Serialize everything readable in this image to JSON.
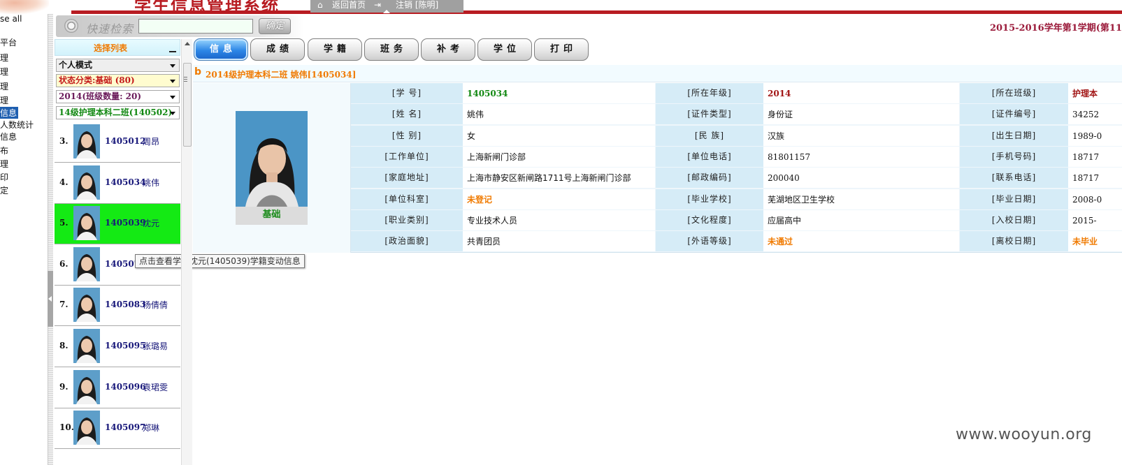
{
  "header": {
    "system_title": "学生信息管理系统",
    "nav_home": "返回首页",
    "nav_logout": "注销 [陈明]",
    "term": "2015-2016学年第1学期(第11"
  },
  "left_tree": {
    "items": [
      "se all",
      "平台",
      "理",
      "理",
      "理",
      "理",
      "信息",
      "人数统计",
      "信息",
      "布",
      "理",
      "印",
      "定"
    ],
    "selected_index": 6
  },
  "search": {
    "label": "快速检索",
    "value": "",
    "button": "确定"
  },
  "select_panel": {
    "title": "选择列表",
    "dropdowns": [
      {
        "value": "个人模式",
        "color": "#111111",
        "bg": "#eeeeee"
      },
      {
        "value": "状态分类:基础  (80)",
        "color": "#c41a1a",
        "bg": "#fffccf"
      },
      {
        "value": "2014(班级数量: 20)",
        "color": "#6a1a5a",
        "bg": "#ffffff"
      },
      {
        "value": "14级护理本科二班(140502)",
        "color": "#118811",
        "bg": "#ffffff"
      }
    ]
  },
  "students": [
    {
      "index": "3.",
      "id": "1405012",
      "name": "周昂",
      "active": false
    },
    {
      "index": "4.",
      "id": "1405034",
      "name": "姚伟",
      "active": false
    },
    {
      "index": "5.",
      "id": "1405039",
      "name": "沈元",
      "active": true
    },
    {
      "index": "6.",
      "id": "1405073",
      "name": "",
      "active": false
    },
    {
      "index": "7.",
      "id": "1405083",
      "name": "杨倩倩",
      "active": false
    },
    {
      "index": "8.",
      "id": "1405095",
      "name": "张璐易",
      "active": false
    },
    {
      "index": "9.",
      "id": "1405096",
      "name": "袁珺雯",
      "active": false
    },
    {
      "index": "10.",
      "id": "1405097",
      "name": "郑琳",
      "active": false
    }
  ],
  "tooltip": "点击查看学生沈元(1405039)学籍变动信息",
  "tabs": [
    "信息",
    "成绩",
    "学籍",
    "班务",
    "补考",
    "学位",
    "打印"
  ],
  "active_tab": 0,
  "info_bar": {
    "letter": "b",
    "text": "2014级护理本科二班  姚伟[1405034]"
  },
  "detail": {
    "photo_caption": "基础",
    "rows": [
      [
        [
          "[学      号]",
          "1405034",
          "green"
        ],
        [
          "[所在年级]",
          "2014",
          "red"
        ],
        [
          "[所在班级]",
          "护理本",
          "red"
        ]
      ],
      [
        [
          "[姓      名]",
          "姚伟",
          ""
        ],
        [
          "[证件类型]",
          "身份证",
          ""
        ],
        [
          "[证件编号]",
          "34252",
          "num"
        ]
      ],
      [
        [
          "[性      别]",
          "女",
          ""
        ],
        [
          "[民      族]",
          "汉族",
          ""
        ],
        [
          "[出生日期]",
          "1989-0",
          "num"
        ]
      ],
      [
        [
          "[工作单位]",
          "上海新闸门诊部",
          ""
        ],
        [
          "[单位电话]",
          "81801157",
          "num"
        ],
        [
          "[手机号码]",
          "18717",
          "num"
        ]
      ],
      [
        [
          "[家庭地址]",
          "上海市静安区新闸路1711号上海新闸门诊部",
          ""
        ],
        [
          "[邮政编码]",
          "200040",
          "num"
        ],
        [
          "[联系电话]",
          "18717",
          "num"
        ]
      ],
      [
        [
          "[单位科室]",
          "未登记",
          "orange"
        ],
        [
          "[毕业学校]",
          "芜湖地区卫生学校",
          ""
        ],
        [
          "[毕业日期]",
          "2008-0",
          "num"
        ]
      ],
      [
        [
          "[职业类别]",
          "专业技术人员",
          ""
        ],
        [
          "[文化程度]",
          "应届高中",
          ""
        ],
        [
          "[入校日期]",
          "2015-",
          "num"
        ]
      ],
      [
        [
          "[政治面貌]",
          "共青团员",
          ""
        ],
        [
          "[外语等级]",
          "未通过",
          "orange"
        ],
        [
          "[离校日期]",
          "未毕业",
          "orange"
        ]
      ]
    ]
  },
  "watermark": "www.wooyun.org"
}
